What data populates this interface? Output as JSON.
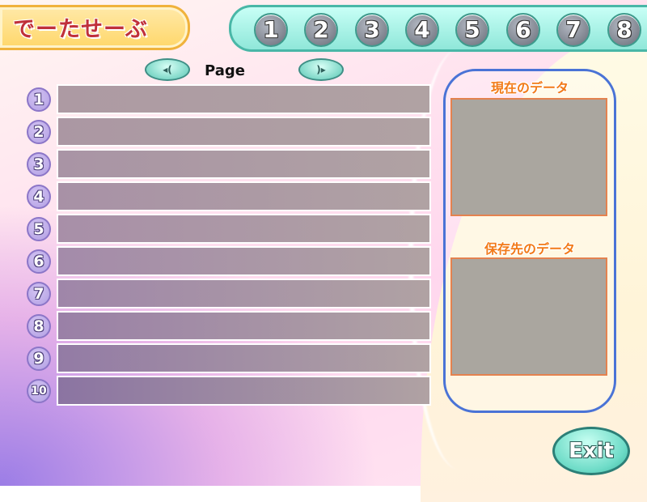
{
  "title": "でーたせーぶ",
  "slots": [
    "1",
    "2",
    "3",
    "4",
    "5",
    "6",
    "7",
    "8"
  ],
  "paging": {
    "prev_label": "◂(",
    "next_label": ")▸",
    "page_label": "Page"
  },
  "rows": [
    {
      "number": "1",
      "color": "#ad9aa3"
    },
    {
      "number": "2",
      "color": "#ab97a3"
    },
    {
      "number": "3",
      "color": "#a994a5"
    },
    {
      "number": "4",
      "color": "#a891a6"
    },
    {
      "number": "5",
      "color": "#a88fa8"
    },
    {
      "number": "6",
      "color": "#a48baa"
    },
    {
      "number": "7",
      "color": "#9f86a9"
    },
    {
      "number": "8",
      "color": "#9a80a7"
    },
    {
      "number": "9",
      "color": "#937ba5"
    },
    {
      "number": "10",
      "color": "#8b74a2"
    }
  ],
  "panel": {
    "current_label": "現在のデータ",
    "dest_label": "保存先のデータ"
  },
  "exit_label": "Exit",
  "colors": {
    "accent_title": "#c0303a",
    "panel_label": "#f27a18",
    "panel_border": "#4a73d6"
  }
}
